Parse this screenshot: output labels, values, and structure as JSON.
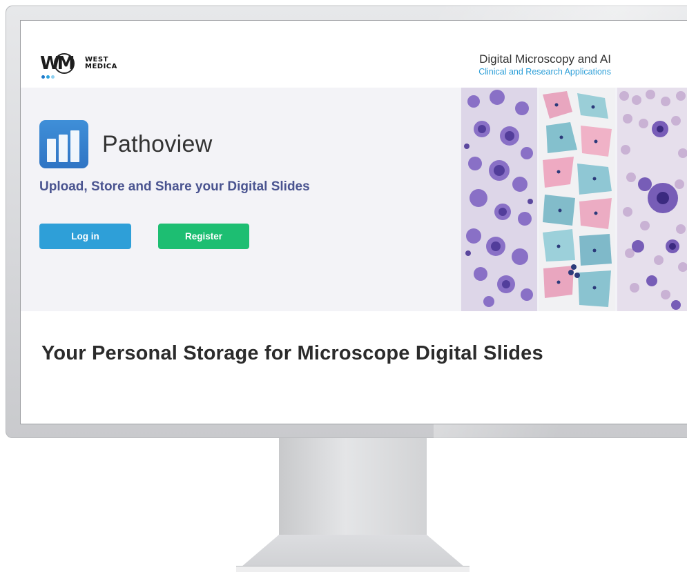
{
  "header": {
    "brand": {
      "line1": "WEST",
      "line2": "MEDICA",
      "mark": "WM"
    },
    "title": "Digital Microscopy and AI",
    "subtitle": "Clinical and Research Applications"
  },
  "hero": {
    "app_name": "Pathoview",
    "tagline": "Upload, Store and Share your Digital Slides",
    "buttons": {
      "login": "Log in",
      "register": "Register"
    }
  },
  "section": {
    "heading": "Your Personal Storage for Microscope Digital Slides"
  },
  "colors": {
    "accent_blue": "#2e9fd8",
    "accent_green": "#1dbe72",
    "tagline": "#4a5490",
    "hero_bg": "#f3f3f7",
    "app_icon": "#3f8fd8"
  },
  "icons": [
    "west-medica-logo-icon",
    "pathoview-app-icon",
    "microscopy-slide-image"
  ]
}
